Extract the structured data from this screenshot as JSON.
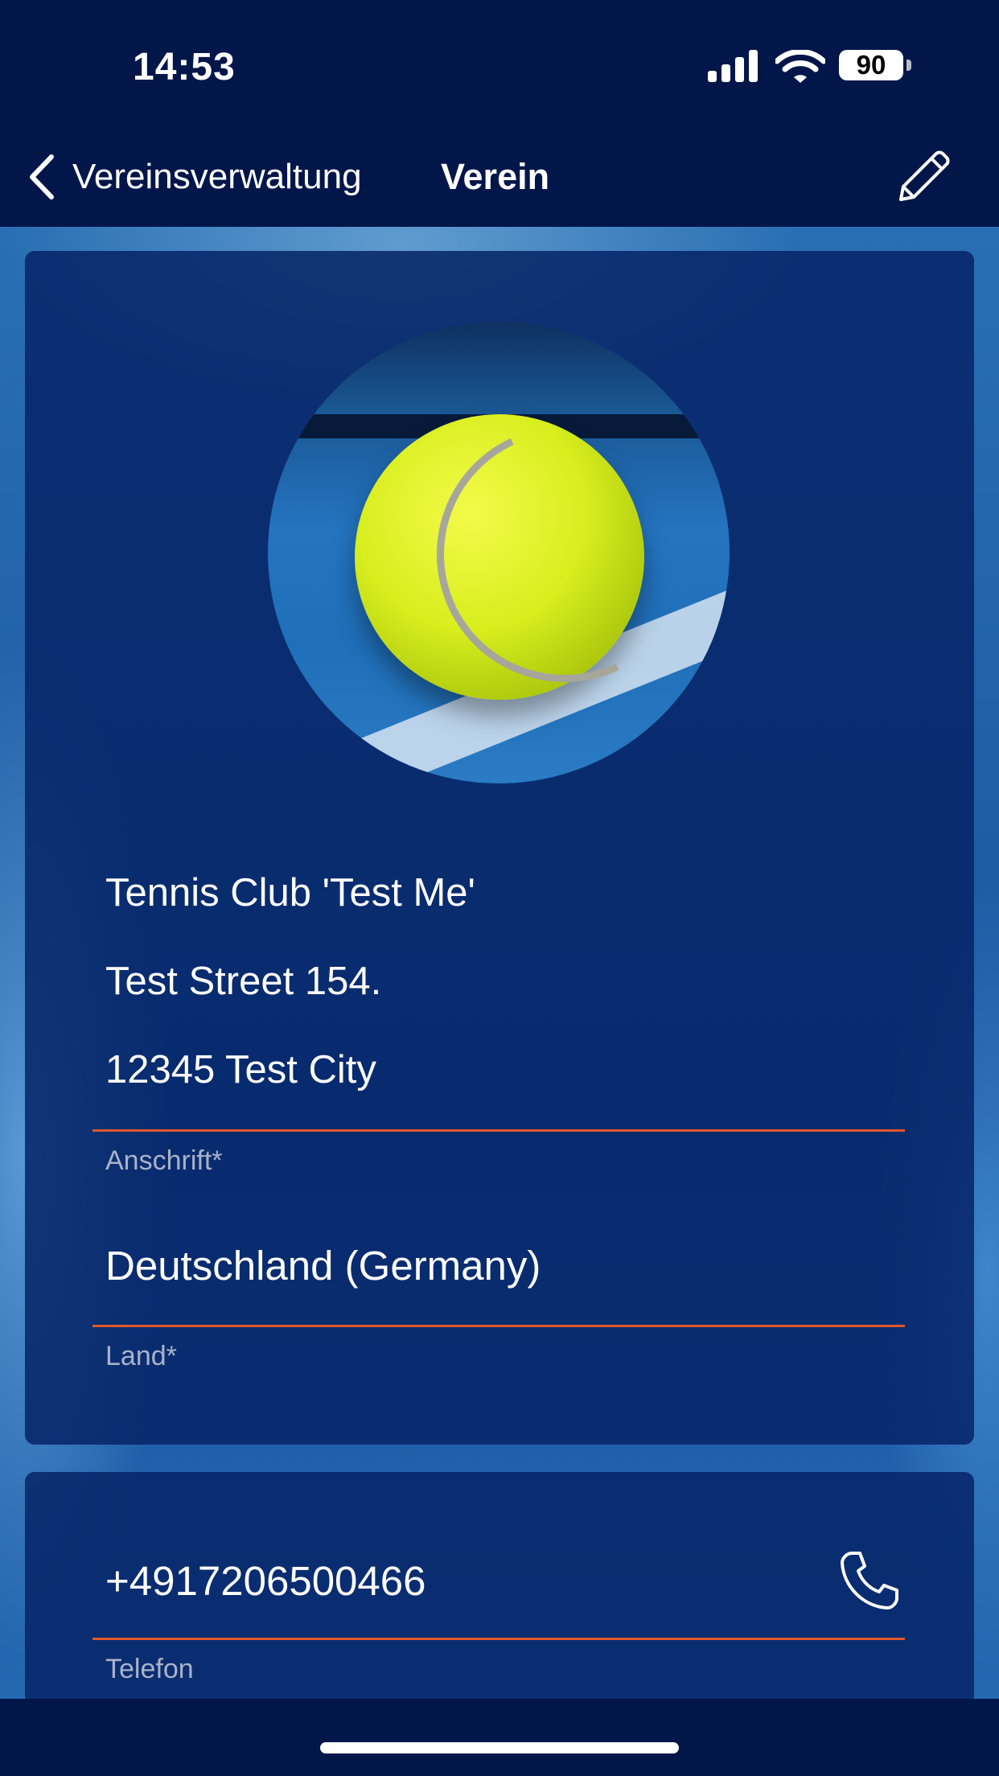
{
  "status_bar": {
    "time": "14:53",
    "battery": "90"
  },
  "nav": {
    "back_label": "Vereinsverwaltung",
    "title": "Verein"
  },
  "address_card": {
    "address_lines": [
      "Tennis Club 'Test Me'",
      "Test Street 154.",
      "12345 Test City"
    ],
    "address_label": "Anschrift*",
    "country_value": "Deutschland  (Germany)",
    "country_label": "Land*"
  },
  "contact_card": {
    "phone_value": "+4917206500466",
    "phone_label": "Telefon"
  },
  "colors": {
    "background": "#03164a",
    "card": "#062466",
    "accent_underline": "#e0582b",
    "label": "#a9b2c8"
  },
  "icons": [
    "chevron-left-icon",
    "pencil-icon",
    "phone-icon",
    "signal-icon",
    "wifi-icon",
    "battery-icon"
  ]
}
